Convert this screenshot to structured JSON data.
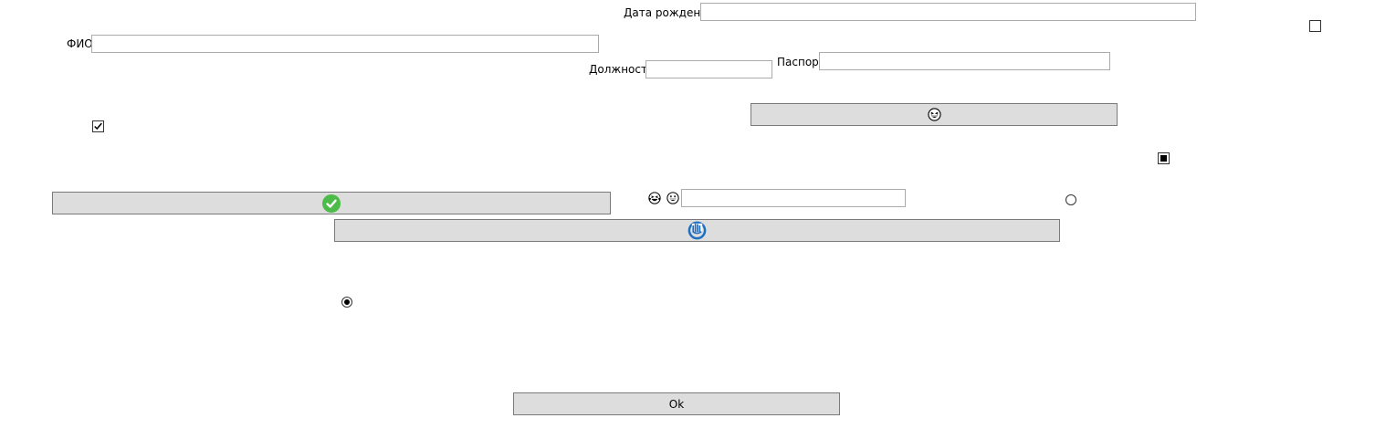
{
  "form": {
    "birth_date_label": "Дата рождения",
    "birth_date_value": "",
    "fio_label": "ФИО",
    "fio_value": "",
    "position_label": "Должность",
    "position_value": "",
    "passport_label": "Паспорт",
    "passport_value": "",
    "emoji_field_value": ""
  },
  "buttons": {
    "emoji_button_icon": "grinning-squint-emoji-icon",
    "check_button_icon": "green-check-circle-icon",
    "blue_button_icon": "blue-circle-hand-icon",
    "ok_label": "Ok"
  },
  "checkboxes": {
    "top_right_checked": false,
    "left_checked": true,
    "right_indeterminate": true
  },
  "radios": {
    "right_selected": false,
    "left_selected": true
  },
  "colors": {
    "button_bg": "#dddddd",
    "button_border": "#7a7a7a",
    "field_border": "#ababab",
    "check_green": "#4cbb47",
    "icon_blue": "#1f6fc0"
  }
}
